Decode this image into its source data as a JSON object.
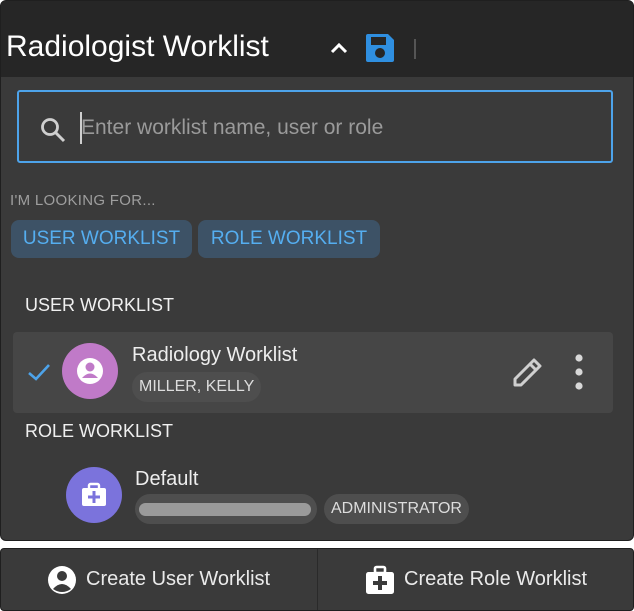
{
  "header": {
    "title": "Radiologist Worklist"
  },
  "search": {
    "placeholder": "Enter worklist name, user or role"
  },
  "filters": {
    "heading": "I'M LOOKING FOR...",
    "chips": [
      "USER WORKLIST",
      "ROLE WORKLIST"
    ]
  },
  "user_section": {
    "heading": "USER WORKLIST",
    "items": [
      {
        "name": "Radiology Worklist",
        "owner": "MILLER, KELLY",
        "selected": true
      }
    ]
  },
  "role_section": {
    "heading": "ROLE WORKLIST",
    "items": [
      {
        "name": "Default",
        "role": "ADMINISTRATOR"
      }
    ]
  },
  "footer": {
    "create_user": "Create User Worklist",
    "create_role": "Create Role Worklist"
  },
  "colors": {
    "accent": "#4da3ea",
    "chip_bg": "#3d5266",
    "user_avatar": "#c07ac8",
    "role_avatar": "#7b73dc"
  }
}
